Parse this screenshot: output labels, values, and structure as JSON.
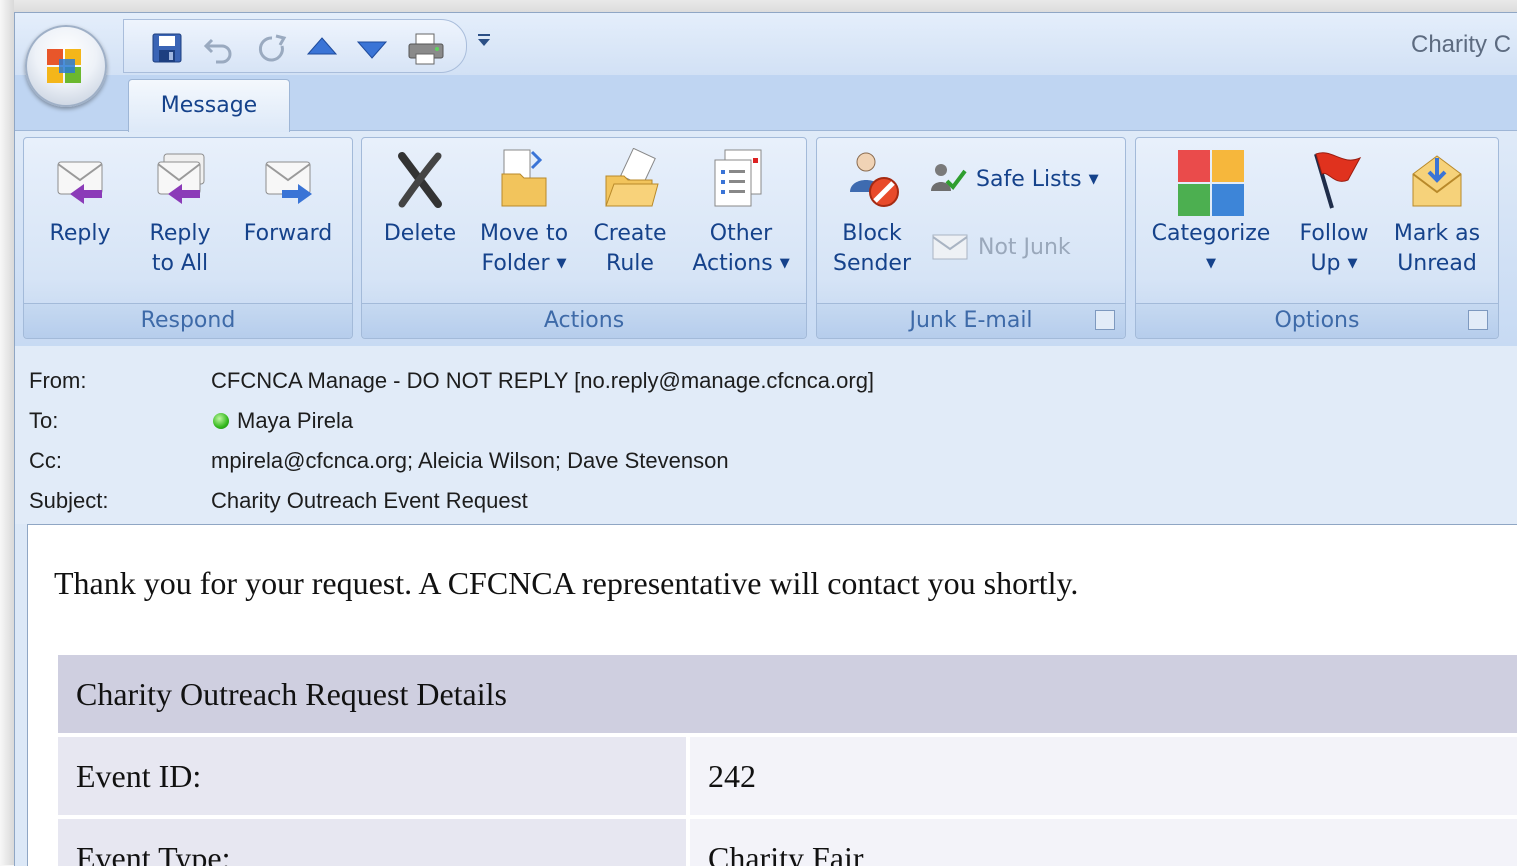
{
  "window": {
    "title": "Charity C"
  },
  "ribbon": {
    "tab": "Message",
    "groups": {
      "respond": {
        "label": "Respond",
        "reply": "Reply",
        "reply_all_1": "Reply",
        "reply_all_2": "to All",
        "forward": "Forward"
      },
      "actions": {
        "label": "Actions",
        "delete": "Delete",
        "move_1": "Move to",
        "move_2": "Folder",
        "create_1": "Create",
        "create_2": "Rule",
        "other_1": "Other",
        "other_2": "Actions"
      },
      "junk": {
        "label": "Junk E-mail",
        "block_1": "Block",
        "block_2": "Sender",
        "safe_lists": "Safe Lists",
        "not_junk": "Not Junk"
      },
      "options": {
        "label": "Options",
        "categorize": "Categorize",
        "follow_1": "Follow",
        "follow_2": "Up",
        "mark_1": "Mark as",
        "mark_2": "Unread"
      }
    }
  },
  "header": {
    "from_label": "From:",
    "from_value": "CFCNCA Manage - DO NOT REPLY [no.reply@manage.cfcnca.org]",
    "to_label": "To:",
    "to_value": "Maya Pirela",
    "cc_label": "Cc:",
    "cc_value": "mpirela@cfcnca.org; Aleicia Wilson; Dave Stevenson",
    "subject_label": "Subject:",
    "subject_value": "Charity Outreach Event Request"
  },
  "body": {
    "intro": "Thank you for your request. A CFCNCA representative will contact you shortly.",
    "table_title": "Charity Outreach Request Details",
    "rows": [
      {
        "key": "Event ID:",
        "value": "242"
      },
      {
        "key": "Event Type:",
        "value": "Charity Fair"
      }
    ]
  },
  "colors": {
    "ribbon_text": "#15428b",
    "group_label": "#3e6aa8",
    "table_header_bg": "#cfcfe0",
    "presence_online": "#33b81d"
  }
}
